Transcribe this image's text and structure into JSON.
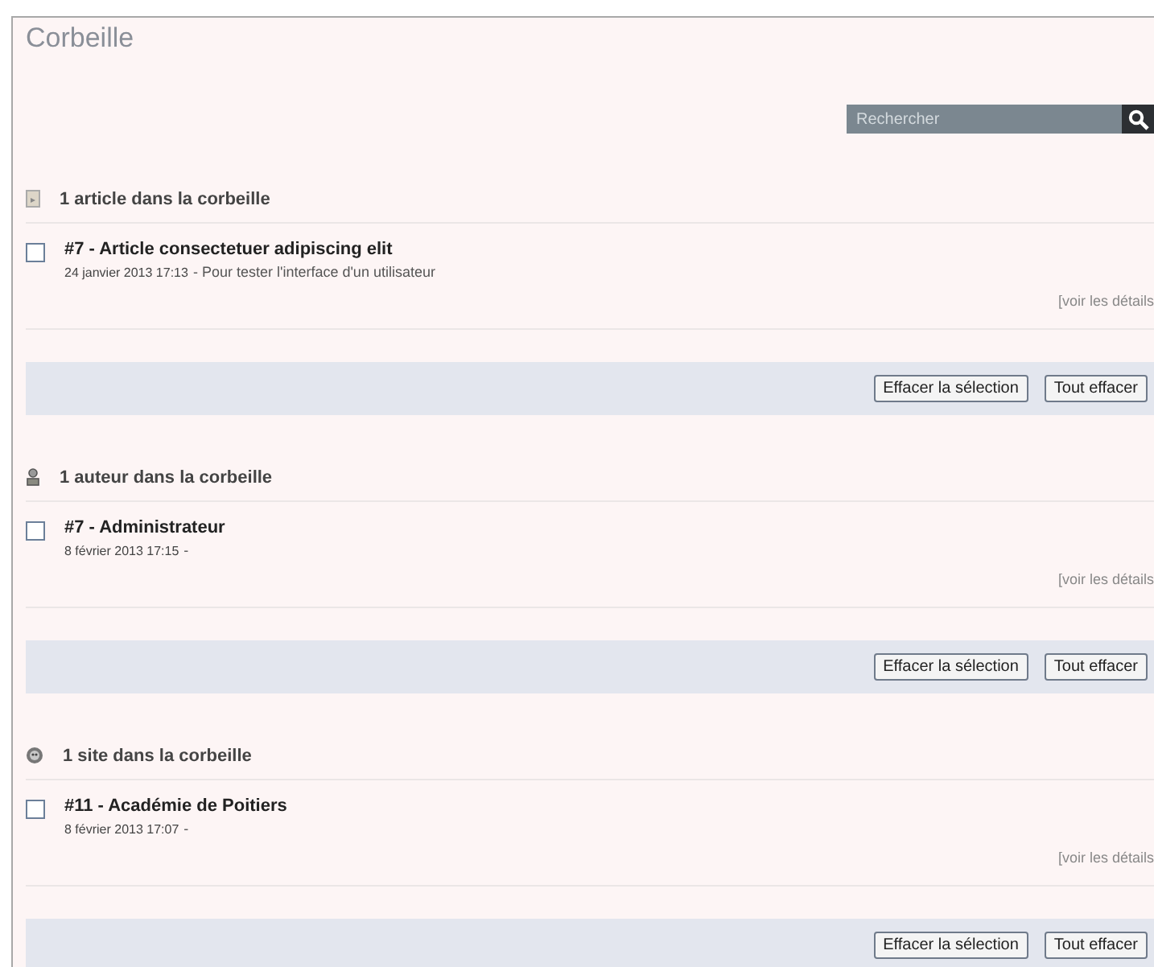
{
  "title": "Corbeille",
  "search": {
    "placeholder": "Rechercher"
  },
  "sections": [
    {
      "kind": "article",
      "heading": "1 article dans la corbeille",
      "items": [
        {
          "checked": false,
          "title": "#7 - Article consectetuer adipiscing elit",
          "date": "24 janvier 2013 17:13",
          "summary": "- Pour tester l'interface d'un utilisateur",
          "details": "[voir les détails"
        }
      ],
      "buttons": [
        "Effacer la sélection",
        "Tout effacer"
      ]
    },
    {
      "kind": "author",
      "heading": "1 auteur dans la corbeille",
      "items": [
        {
          "checked": false,
          "title": "#7 - Administrateur",
          "date": "8 février 2013 17:15",
          "summary": "-",
          "details": "[voir les détails"
        }
      ],
      "buttons": [
        "Effacer la sélection",
        "Tout effacer"
      ]
    },
    {
      "kind": "site",
      "heading": "1 site dans la corbeille",
      "items": [
        {
          "checked": false,
          "title": "#11 - Académie de Poitiers",
          "date": "8 février 2013 17:07",
          "summary": "-",
          "details": "[voir les détails"
        }
      ],
      "buttons": [
        "Effacer la sélection",
        "Tout effacer"
      ]
    }
  ]
}
